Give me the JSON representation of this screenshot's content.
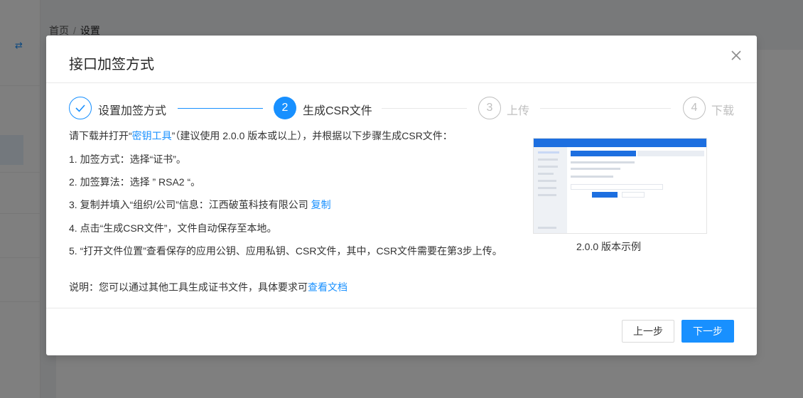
{
  "background": {
    "breadcrumb": {
      "home": "首页",
      "separator": "/",
      "current": "设置"
    }
  },
  "modal": {
    "title": "接口加签方式",
    "steps": [
      {
        "number": "1",
        "label": "设置加签方式",
        "status": "finished"
      },
      {
        "number": "2",
        "label": "生成CSR文件",
        "status": "active"
      },
      {
        "number": "3",
        "label": "上传",
        "status": "waiting"
      },
      {
        "number": "4",
        "label": "下载",
        "status": "waiting"
      }
    ],
    "intro": {
      "prefix": "请下载并打开“",
      "link": "密钥工具",
      "suffix": "”（建议使用 2.0.0 版本或以上），并根据以下步骤生成CSR文件："
    },
    "instructions": {
      "line1": "1. 加签方式：选择“证书”。",
      "line2": "2. 加签算法：选择 ” RSA2 “。",
      "line3_text": "3. 复制并填入“组织/公司”信息：江西破茧科技有限公司 ",
      "line3_link": "复制",
      "line4": "4. 点击“生成CSR文件”，文件自动保存至本地。",
      "line5": "5. “打开文件位置”查看保存的应用公钥、应用私钥、CSR文件，其中，CSR文件需要在第3步上传。"
    },
    "note": {
      "text": "说明：您可以通过其他工具生成证书文件，具体要求可",
      "link": "查看文档"
    },
    "example_caption": "2.0.0 版本示例",
    "buttons": {
      "prev": "上一步",
      "next": "下一步"
    }
  },
  "colors": {
    "primary": "#1890ff",
    "muted": "#bfbfbf",
    "text": "#333333"
  }
}
